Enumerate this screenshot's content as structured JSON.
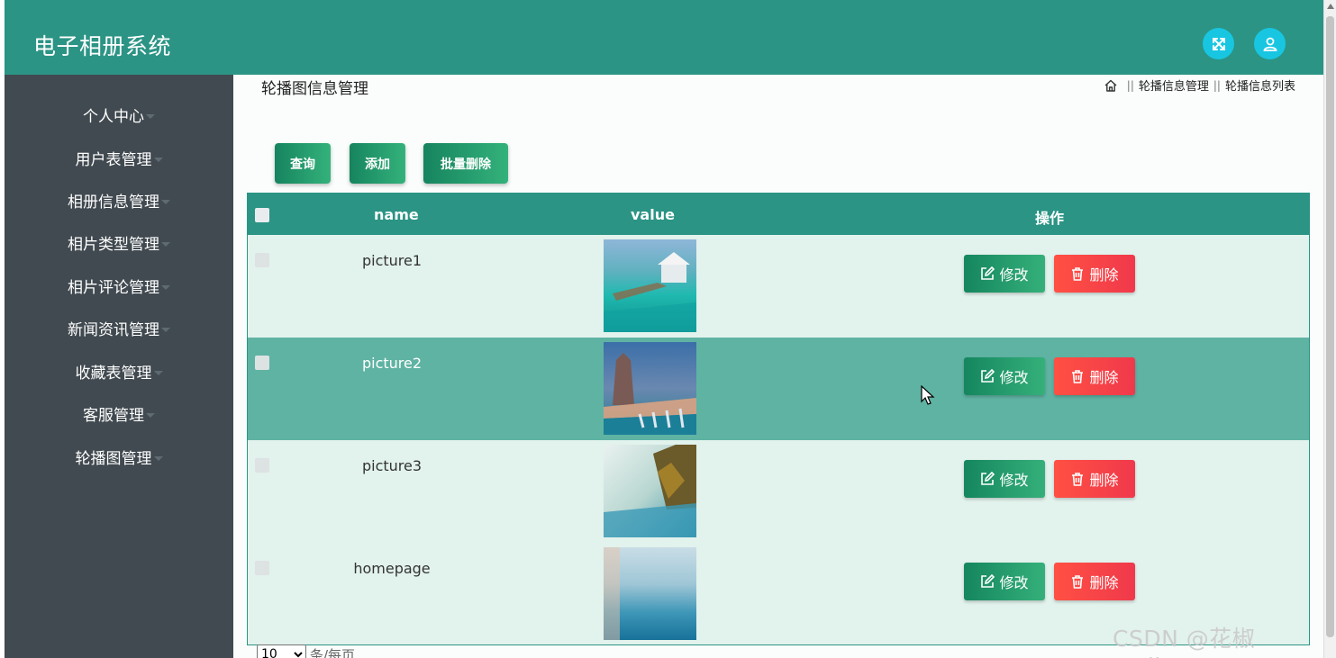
{
  "header": {
    "title": "电子相册系统"
  },
  "sidebar": {
    "items": [
      {
        "label": "个人中心"
      },
      {
        "label": "用户表管理"
      },
      {
        "label": "相册信息管理"
      },
      {
        "label": "相片类型管理"
      },
      {
        "label": "相片评论管理"
      },
      {
        "label": "新闻资讯管理"
      },
      {
        "label": "收藏表管理"
      },
      {
        "label": "客服管理"
      },
      {
        "label": "轮播图管理"
      }
    ]
  },
  "page": {
    "title": "轮播图信息管理"
  },
  "breadcrumb": {
    "sep": "||",
    "items": [
      "轮播信息管理",
      "轮播信息列表"
    ]
  },
  "actions": {
    "query": "查询",
    "add": "添加",
    "batch_delete": "批量删除"
  },
  "table": {
    "headers": {
      "name": "name",
      "value": "value",
      "ops": "操作"
    },
    "rows": [
      {
        "name": "picture1"
      },
      {
        "name": "picture2"
      },
      {
        "name": "picture3"
      },
      {
        "name": "homepage"
      }
    ],
    "edit_label": "修改",
    "delete_label": "删除"
  },
  "pager": {
    "page_size": "10",
    "suffix": "条/每页"
  },
  "watermark": "CSDN @花椒coding",
  "colors": {
    "header": "#2b9485",
    "sidebar": "#414a50",
    "edit": "#1e9467",
    "delete": "#f5424a",
    "icon_btn": "#18c6e1"
  }
}
